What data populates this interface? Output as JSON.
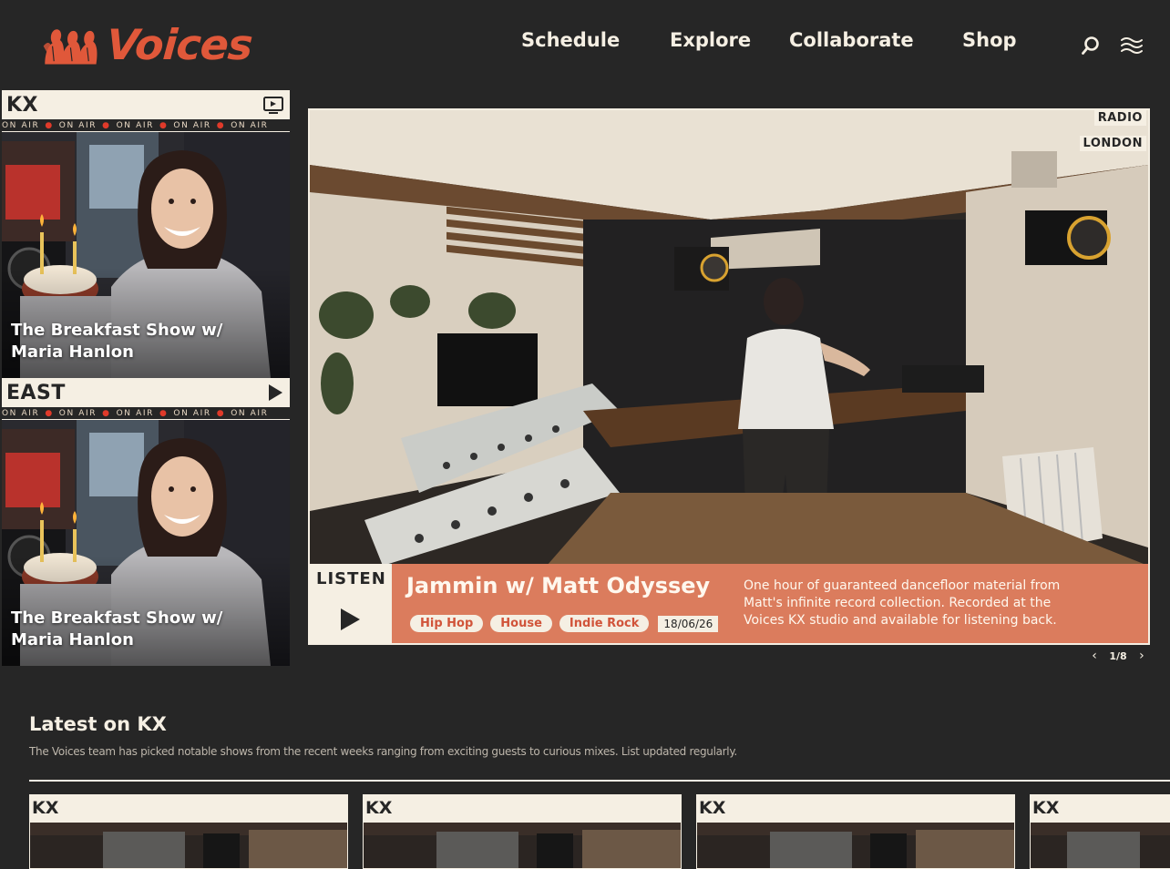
{
  "brand": {
    "name": "Voices",
    "accent": "#e0583a"
  },
  "nav": {
    "items": [
      "Schedule",
      "Explore",
      "Collaborate",
      "Shop"
    ]
  },
  "header_icons": [
    "search-icon",
    "menu-icon"
  ],
  "channels": [
    {
      "name": "KX",
      "ticker": "ON AIR",
      "control_icon": "tv-icon",
      "show_title": "The Breakfast Show w/ Maria Hanlon"
    },
    {
      "name": "EAST",
      "ticker": "ON AIR",
      "control_icon": "play-icon",
      "show_title": "The Breakfast Show w/ Maria Hanlon"
    }
  ],
  "hero": {
    "tags": [
      "RADIO",
      "LONDON"
    ],
    "listen_label": "LISTEN",
    "title": "Jammin w/ Matt Odyssey",
    "genres": [
      "Hip Hop",
      "House",
      "Indie Rock"
    ],
    "date": "18/06/26",
    "description": "One hour of guaranteed dancefloor material from Matt's infinite record collection. Recorded at the Voices KX studio and available for listening back.",
    "pager": {
      "current": 1,
      "total": 8,
      "label": "1/8"
    }
  },
  "latest": {
    "title": "Latest on KX",
    "description": "The Voices team has picked notable shows from the recent weeks ranging from exciting guests to curious mixes. List updated regularly.",
    "cards": [
      {
        "channel": "KX"
      },
      {
        "channel": "KX"
      },
      {
        "channel": "KX"
      },
      {
        "channel": "KX"
      }
    ]
  },
  "colors": {
    "background": "#262626",
    "cream": "#f5efe3",
    "info_panel": "#db7c5d",
    "pill_text": "#d1543a",
    "on_air_dot": "#e03a2a"
  }
}
